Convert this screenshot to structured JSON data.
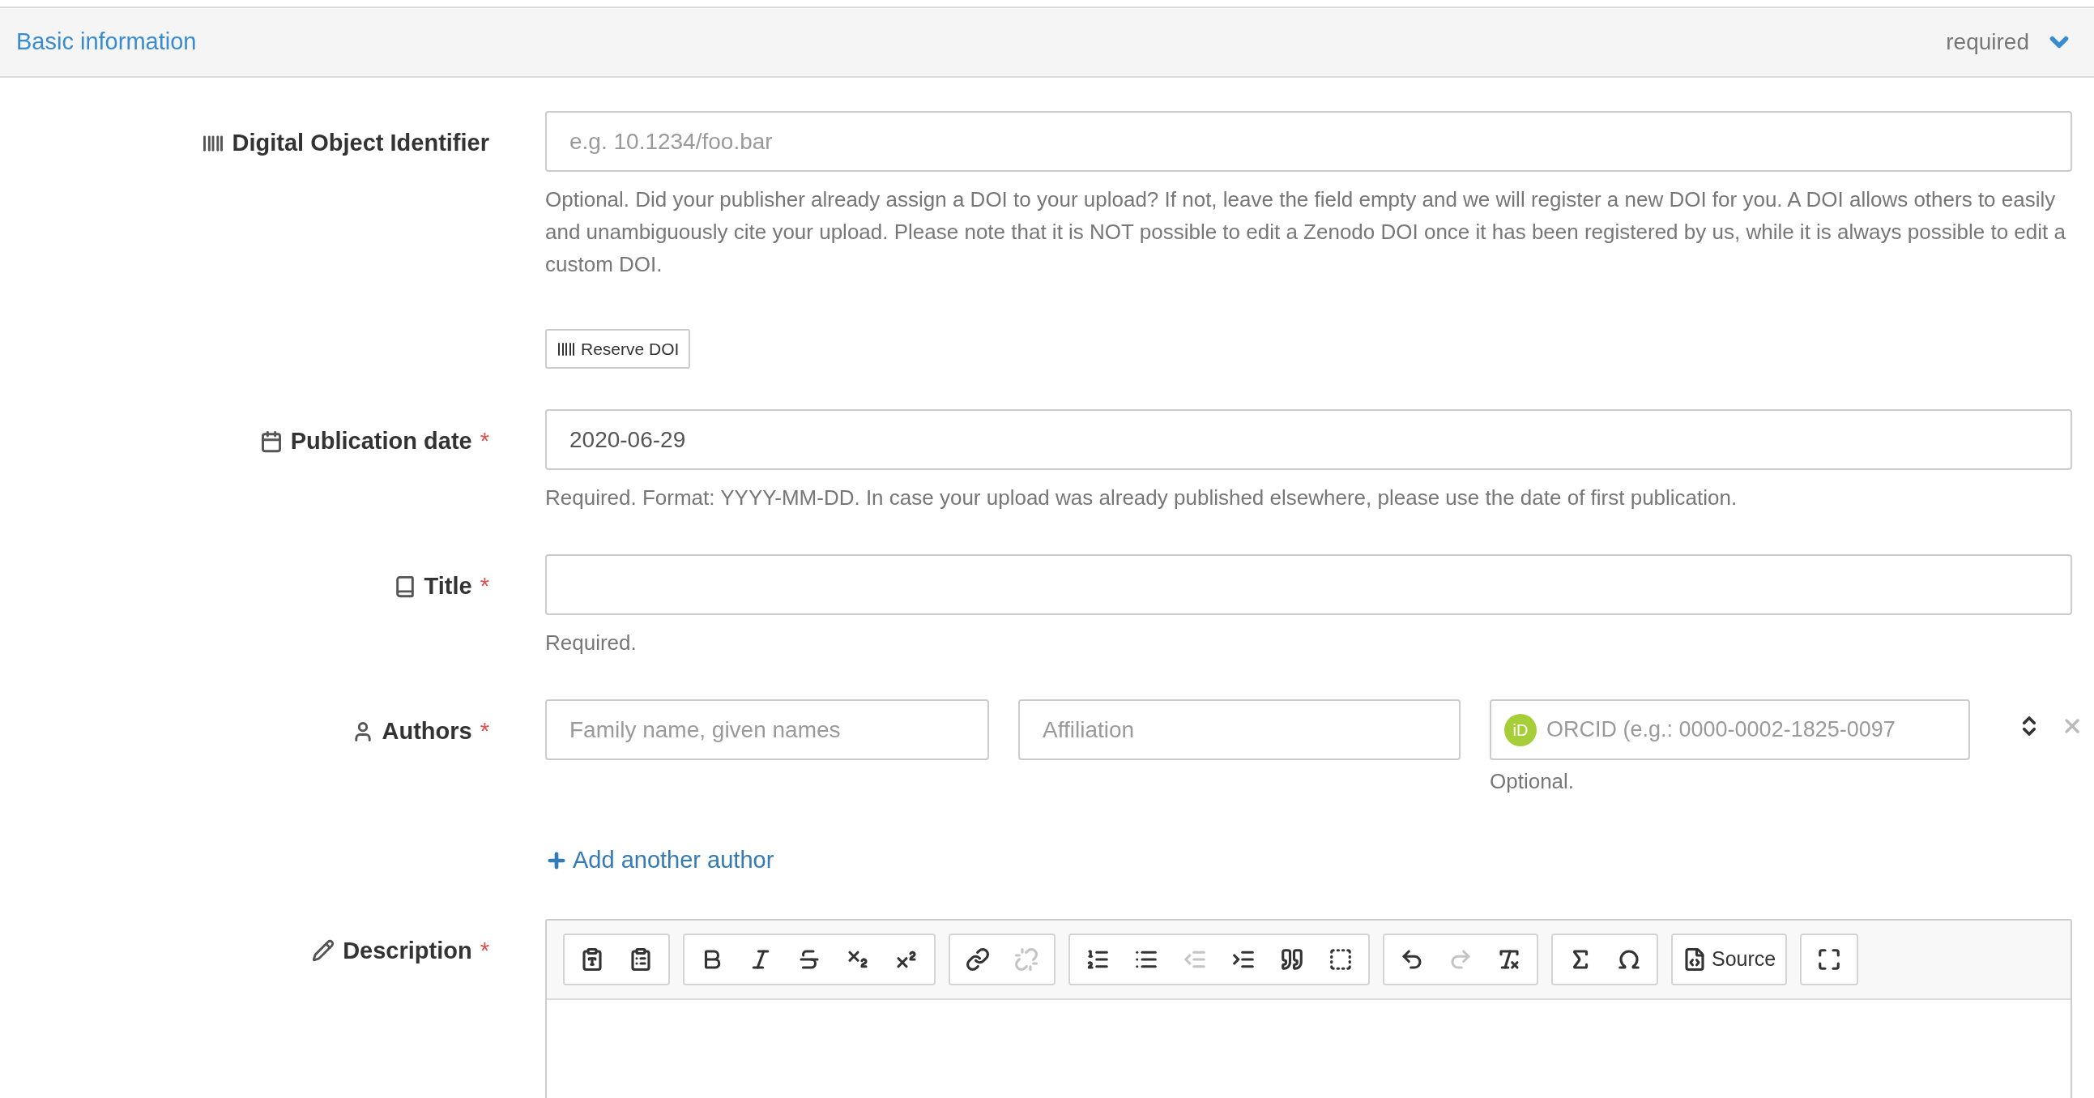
{
  "section": {
    "title": "Basic information",
    "badge": "required",
    "expanded": true
  },
  "fields": [
    {
      "kind": "doi",
      "label": "Digital Object Identifier",
      "placeholder": "e.g. 10.1234/foo.bar",
      "help": "Optional. Did your publisher already assign a DOI to your upload? If not, leave the field empty and we will register a new DOI for you. A DOI allows others to easily and unambiguously cite your upload. Please note that it is NOT possible to edit a Zenodo DOI once it has been registered by us, while it is always possible to edit a custom DOI.",
      "button": "Reserve DOI"
    },
    {
      "kind": "date",
      "label": "Publication date",
      "required_mark": "*",
      "value": "2020-06-29",
      "help": "Required. Format: YYYY-MM-DD. In case your upload was already published elsewhere, please use the date of first publication."
    },
    {
      "kind": "title",
      "label": "Title",
      "required_mark": "*",
      "help": "Required."
    },
    {
      "kind": "authors",
      "label": "Authors",
      "required_mark": "*",
      "authors": [
        {
          "name_placeholder": "Family name, given names",
          "affiliation_placeholder": "Affiliation",
          "orcid_badge": "iD",
          "orcid_placeholder": "ORCID (e.g.: 0000-0002-1825-0097",
          "orcid_help": "Optional."
        }
      ],
      "add_link": "Add another author"
    },
    {
      "kind": "description",
      "label": "Description",
      "required_mark": "*",
      "toolbar": [
        [
          {
            "kind": "paste-text",
            "disabled": false
          },
          {
            "kind": "paste-word",
            "disabled": false
          }
        ],
        [
          {
            "kind": "bold",
            "disabled": false
          },
          {
            "kind": "italic",
            "disabled": false
          },
          {
            "kind": "strike",
            "disabled": false
          },
          {
            "kind": "subscript",
            "disabled": false
          },
          {
            "kind": "superscript",
            "disabled": false
          }
        ],
        [
          {
            "kind": "link",
            "disabled": false
          },
          {
            "kind": "unlink",
            "disabled": true
          }
        ],
        [
          {
            "kind": "ordered-list",
            "disabled": false
          },
          {
            "kind": "bullet-list",
            "disabled": false
          },
          {
            "kind": "outdent",
            "disabled": true
          },
          {
            "kind": "indent",
            "disabled": false
          },
          {
            "kind": "blockquote",
            "disabled": false
          },
          {
            "kind": "div",
            "disabled": false
          }
        ],
        [
          {
            "kind": "undo",
            "disabled": false
          },
          {
            "kind": "redo",
            "disabled": true
          },
          {
            "kind": "remove-format",
            "disabled": false
          }
        ],
        [
          {
            "kind": "sigma",
            "disabled": false
          },
          {
            "kind": "omega",
            "disabled": false
          }
        ],
        [
          {
            "kind": "source",
            "label": "Source",
            "disabled": false
          }
        ],
        [
          {
            "kind": "maximize",
            "disabled": false
          }
        ]
      ]
    }
  ]
}
